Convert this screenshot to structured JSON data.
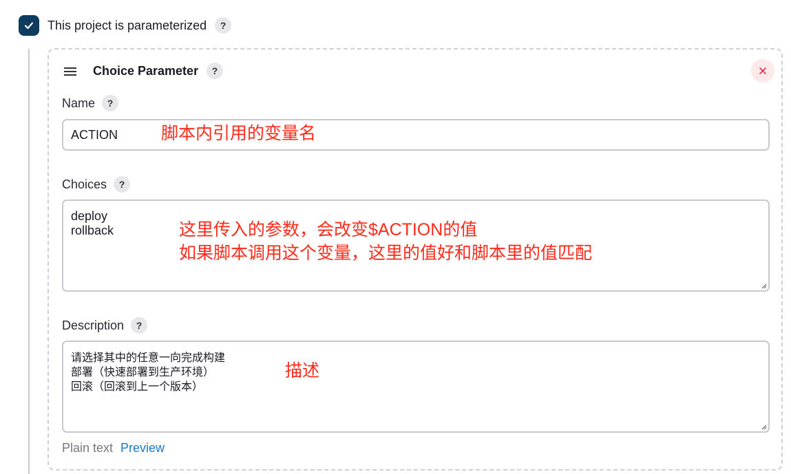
{
  "parameterized": {
    "checked": true,
    "label": "This project is parameterized",
    "help": "?"
  },
  "param": {
    "title": "Choice Parameter",
    "title_help": "?",
    "close_label": "×",
    "name_label": "Name",
    "name_help": "?",
    "name_value": "ACTION",
    "choices_label": "Choices",
    "choices_help": "?",
    "choices_value": "deploy\nrollback",
    "description_label": "Description",
    "description_help": "?",
    "description_value": "请选择其中的任意一向完成构建\n部署（快速部署到生产环境）\n回滚（回滚到上一个版本）",
    "plain_text_label": "Plain text",
    "preview_label": "Preview"
  },
  "annotations": {
    "name_note": "脚本内引用的变量名",
    "choices_note": "这里传入的参数，会改变$ACTION的值\n如果脚本调用这个变量，这里的值好和脚本里的值匹配",
    "description_note": "描述"
  },
  "colors": {
    "checkbox": "#0f3b5f",
    "annotation": "#ff2a1a",
    "link": "#1976d2",
    "close_bg": "#fde8ea",
    "close_fg": "#e0314b"
  }
}
